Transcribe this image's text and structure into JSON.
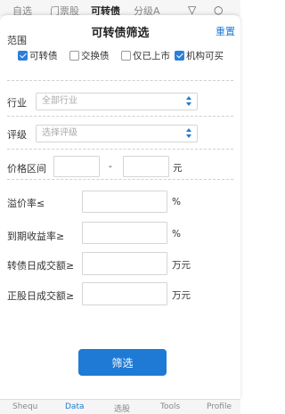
{
  "background_tabs": {
    "items": [
      "自选",
      "门票股",
      "可转债",
      "分级A"
    ],
    "active_index": 2
  },
  "sheet": {
    "title": "可转债筛选",
    "reset_label": "重置"
  },
  "scope": {
    "label": "范围",
    "options": [
      {
        "label": "可转债",
        "checked": true
      },
      {
        "label": "交换债",
        "checked": false
      },
      {
        "label": "仅已上市",
        "checked": false
      },
      {
        "label": "机构可买",
        "checked": true
      }
    ]
  },
  "industry": {
    "label": "行业",
    "value": "全部行业"
  },
  "rating": {
    "label": "评级",
    "placeholder": "选择评级"
  },
  "price_range": {
    "label": "价格区间",
    "min_value": "",
    "max_value": "",
    "separator": "-",
    "unit": "元"
  },
  "premium_rate": {
    "label": "溢价率≤",
    "value": "",
    "unit": "%"
  },
  "ytm": {
    "label": "到期收益率≥",
    "value": "",
    "unit": "%"
  },
  "cb_turnover": {
    "label": "转债日成交额≥",
    "value": "",
    "unit": "万元"
  },
  "stock_turnover": {
    "label": "正股日成交额≥",
    "value": "",
    "unit": "万元"
  },
  "filter_button_label": "筛选",
  "bottom_nav": {
    "items": [
      "Shequ",
      "Data",
      "选股",
      "Tools",
      "Profile"
    ],
    "active_index": 1
  },
  "colors": {
    "accent": "#1f7ad6",
    "checked": "#2c7fd8"
  }
}
